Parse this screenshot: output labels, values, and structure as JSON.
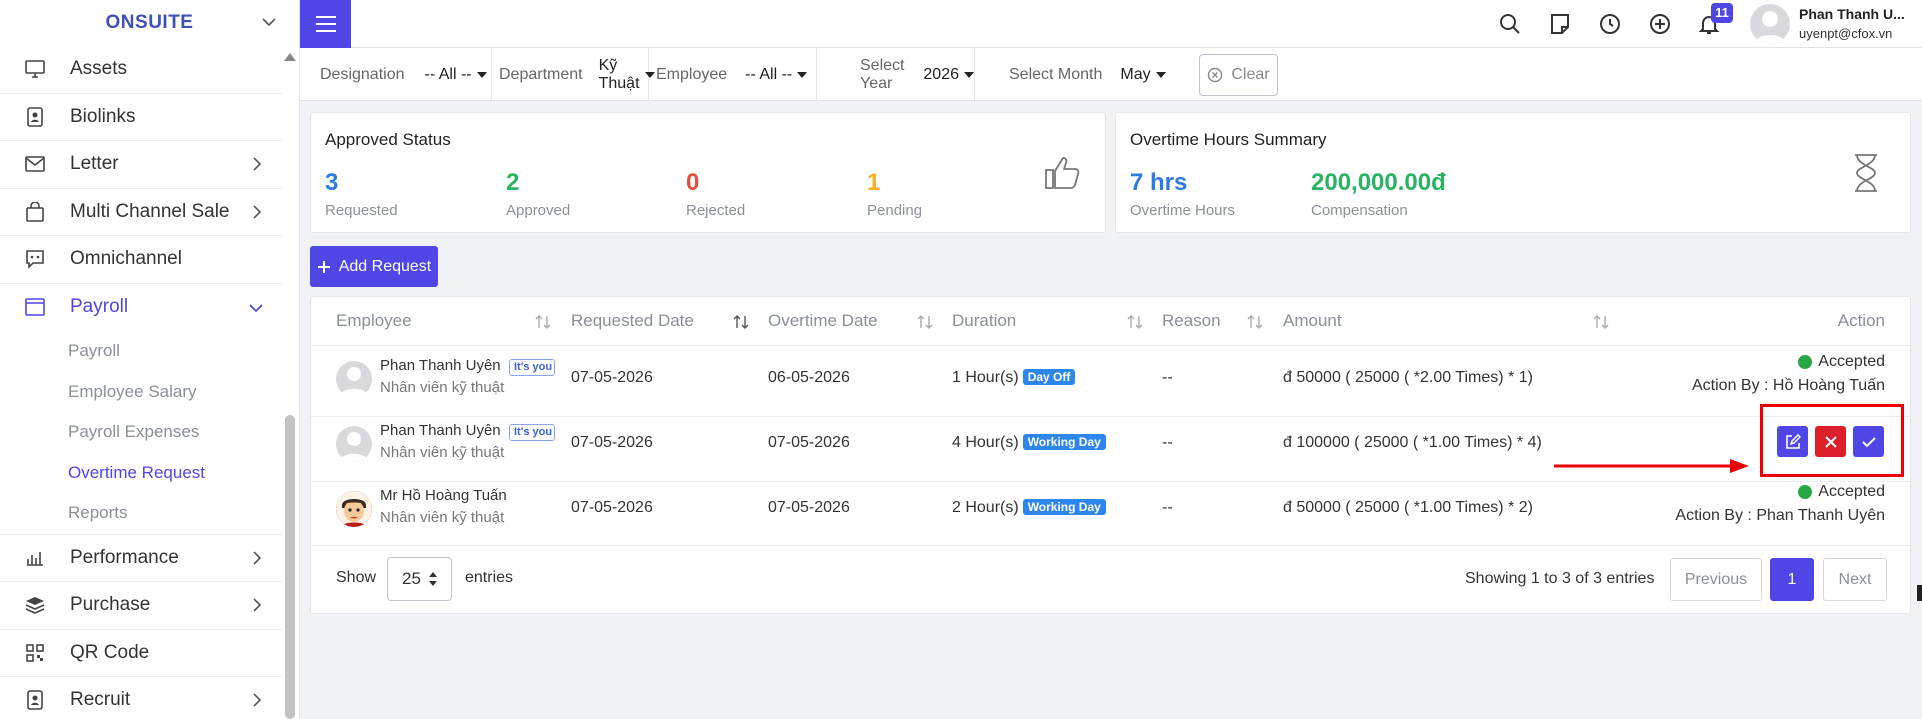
{
  "sidebar": {
    "brand": "ONSUITE",
    "items": [
      {
        "label": "Assets",
        "icon": "monitor-icon",
        "has_arrow": false
      },
      {
        "label": "Biolinks",
        "icon": "badge-icon",
        "has_arrow": false
      },
      {
        "label": "Letter",
        "icon": "envelope-icon",
        "has_arrow": true
      },
      {
        "label": "Multi Channel Sale",
        "icon": "shopping-bag-icon",
        "has_arrow": true
      },
      {
        "label": "Omnichannel",
        "icon": "chat-icon",
        "has_arrow": false
      },
      {
        "label": "Payroll",
        "icon": "window-icon",
        "has_arrow": true,
        "active": true
      }
    ],
    "payroll_sub": [
      "Payroll",
      "Employee Salary",
      "Payroll Expenses",
      "Overtime Request",
      "Reports"
    ],
    "active_sub": "Overtime Request",
    "items_after": [
      {
        "label": "Performance",
        "icon": "bar-chart-icon",
        "has_arrow": true
      },
      {
        "label": "Purchase",
        "icon": "layers-icon",
        "has_arrow": true
      },
      {
        "label": "QR Code",
        "icon": "qr-code-icon",
        "has_arrow": false
      },
      {
        "label": "Recruit",
        "icon": "badge-icon",
        "has_arrow": true
      }
    ]
  },
  "header": {
    "notification_count": "11",
    "user_name": "Phan Thanh U...",
    "user_email": "uyenpt@cfox.vn"
  },
  "filters": {
    "designation_label": "Designation",
    "designation_value": "-- All --",
    "department_label": "Department",
    "department_value": "Kỹ Thuật",
    "employee_label": "Employee",
    "employee_value": "-- All --",
    "year_label": "Select Year",
    "year_value": "2026",
    "month_label": "Select Month",
    "month_value": "May",
    "clear_label": "Clear"
  },
  "approved_status": {
    "title": "Approved Status",
    "stats": [
      {
        "value": "3",
        "label": "Requested",
        "color": "#2c7be5"
      },
      {
        "value": "2",
        "label": "Approved",
        "color": "#28b463"
      },
      {
        "value": "0",
        "label": "Rejected",
        "color": "#e74c3c"
      },
      {
        "value": "1",
        "label": "Pending",
        "color": "#f5b021"
      }
    ]
  },
  "overtime_summary": {
    "title": "Overtime Hours Summary",
    "hours_value": "7 hrs",
    "hours_label": "Overtime Hours",
    "comp_value": "200,000.00đ",
    "comp_label": "Compensation"
  },
  "add_request_label": "Add Request",
  "table": {
    "headers": [
      "Employee",
      "Requested Date",
      "Overtime Date",
      "Duration",
      "Reason",
      "Amount",
      "Action"
    ],
    "rows": [
      {
        "name": "Phan Thanh Uyên",
        "role": "Nhân viên kỹ thuật",
        "you_tag": "It's you",
        "requested": "07-05-2026",
        "overtime": "06-05-2026",
        "duration": "1 Hour(s)",
        "day_tag": "Day Off",
        "reason": "--",
        "amount": "đ 50000 ( 25000 ( *2.00 Times) * 1)",
        "status": "Accepted",
        "action_by": "Action By : Hồ Hoàng Tuấn"
      },
      {
        "name": "Phan Thanh Uyên",
        "role": "Nhân viên kỹ thuật",
        "you_tag": "It's you",
        "requested": "07-05-2026",
        "overtime": "07-05-2026",
        "duration": "4 Hour(s)",
        "day_tag": "Working Day",
        "reason": "--",
        "amount": "đ 100000 ( 25000 ( *1.00 Times) * 4)"
      },
      {
        "name": "Mr Hồ Hoàng Tuấn",
        "role": "Nhân viên kỹ thuật",
        "requested": "07-05-2026",
        "overtime": "07-05-2026",
        "duration": "2 Hour(s)",
        "day_tag": "Working Day",
        "reason": "--",
        "amount": "đ 50000 ( 25000 ( *1.00 Times) * 2)",
        "status": "Accepted",
        "action_by": "Action By : Phan Thanh Uyên"
      }
    ]
  },
  "pagination": {
    "show_label": "Show",
    "page_size": "25",
    "entries_label": "entries",
    "showing": "Showing 1 to 3 of 3 entries",
    "previous": "Previous",
    "current": "1",
    "next": "Next"
  },
  "colors": {
    "accent": "#4f46e5",
    "success": "#28a745",
    "danger": "#dc1f2a",
    "annotation": "#ee0000"
  }
}
